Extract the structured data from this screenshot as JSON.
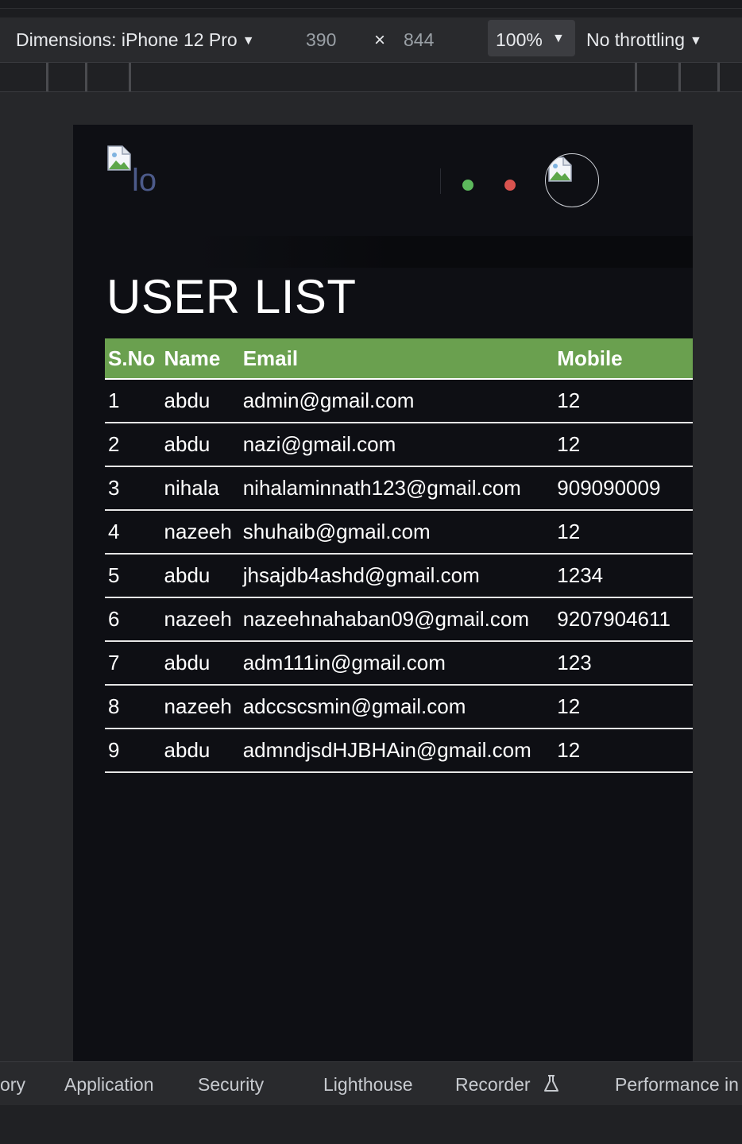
{
  "toolbar": {
    "dimensions_label": "Dimensions: iPhone 12 Pro",
    "width": "390",
    "times": "×",
    "height": "844",
    "zoom": "100%",
    "throttling": "No throttling",
    "caret": "▼"
  },
  "app": {
    "logo_alt": "lo",
    "status_dot_colors": [
      "#5cb85c",
      "#d9534f"
    ],
    "title": "USER LIST",
    "columns": [
      "S.No",
      "Name",
      "Email",
      "Mobile"
    ],
    "rows": [
      {
        "sno": "1",
        "name": "abdu",
        "email": "admin@gmail.com",
        "mobile": "12"
      },
      {
        "sno": "2",
        "name": "abdu",
        "email": "nazi@gmail.com",
        "mobile": "12"
      },
      {
        "sno": "3",
        "name": "nihala",
        "email": "nihalaminnath123@gmail.com",
        "mobile": "909090009"
      },
      {
        "sno": "4",
        "name": "nazeeh",
        "email": "shuhaib@gmail.com",
        "mobile": "12"
      },
      {
        "sno": "5",
        "name": "abdu",
        "email": "jhsajdb4ashd@gmail.com",
        "mobile": "1234"
      },
      {
        "sno": "6",
        "name": "nazeeh",
        "email": "nazeehnahaban09@gmail.com",
        "mobile": "9207904611"
      },
      {
        "sno": "7",
        "name": "abdu",
        "email": "adm111in@gmail.com",
        "mobile": "123"
      },
      {
        "sno": "8",
        "name": "nazeeh",
        "email": "adccscsmin@gmail.com",
        "mobile": "12"
      },
      {
        "sno": "9",
        "name": "abdu",
        "email": "admndjsdHJBHAin@gmail.com",
        "mobile": "12"
      }
    ]
  },
  "devtools_tabs": [
    "ory",
    "Application",
    "Security",
    "Lighthouse",
    "Recorder",
    "Performance in"
  ]
}
